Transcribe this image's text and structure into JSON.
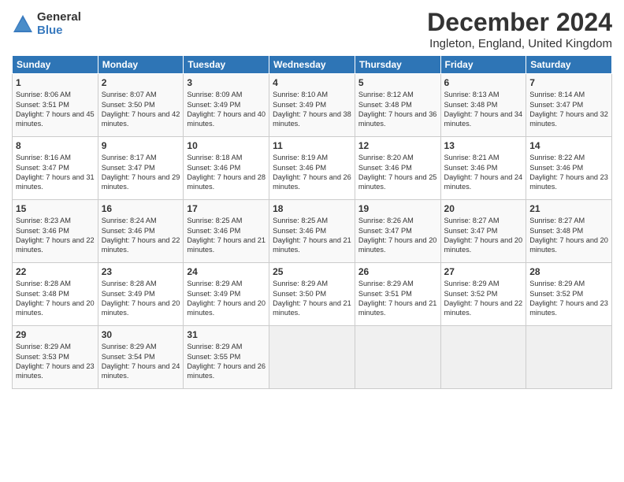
{
  "logo": {
    "general": "General",
    "blue": "Blue"
  },
  "title": "December 2024",
  "subtitle": "Ingleton, England, United Kingdom",
  "headers": [
    "Sunday",
    "Monday",
    "Tuesday",
    "Wednesday",
    "Thursday",
    "Friday",
    "Saturday"
  ],
  "weeks": [
    [
      {
        "day": "1",
        "sunrise": "Sunrise: 8:06 AM",
        "sunset": "Sunset: 3:51 PM",
        "daylight": "Daylight: 7 hours and 45 minutes."
      },
      {
        "day": "2",
        "sunrise": "Sunrise: 8:07 AM",
        "sunset": "Sunset: 3:50 PM",
        "daylight": "Daylight: 7 hours and 42 minutes."
      },
      {
        "day": "3",
        "sunrise": "Sunrise: 8:09 AM",
        "sunset": "Sunset: 3:49 PM",
        "daylight": "Daylight: 7 hours and 40 minutes."
      },
      {
        "day": "4",
        "sunrise": "Sunrise: 8:10 AM",
        "sunset": "Sunset: 3:49 PM",
        "daylight": "Daylight: 7 hours and 38 minutes."
      },
      {
        "day": "5",
        "sunrise": "Sunrise: 8:12 AM",
        "sunset": "Sunset: 3:48 PM",
        "daylight": "Daylight: 7 hours and 36 minutes."
      },
      {
        "day": "6",
        "sunrise": "Sunrise: 8:13 AM",
        "sunset": "Sunset: 3:48 PM",
        "daylight": "Daylight: 7 hours and 34 minutes."
      },
      {
        "day": "7",
        "sunrise": "Sunrise: 8:14 AM",
        "sunset": "Sunset: 3:47 PM",
        "daylight": "Daylight: 7 hours and 32 minutes."
      }
    ],
    [
      {
        "day": "8",
        "sunrise": "Sunrise: 8:16 AM",
        "sunset": "Sunset: 3:47 PM",
        "daylight": "Daylight: 7 hours and 31 minutes."
      },
      {
        "day": "9",
        "sunrise": "Sunrise: 8:17 AM",
        "sunset": "Sunset: 3:47 PM",
        "daylight": "Daylight: 7 hours and 29 minutes."
      },
      {
        "day": "10",
        "sunrise": "Sunrise: 8:18 AM",
        "sunset": "Sunset: 3:46 PM",
        "daylight": "Daylight: 7 hours and 28 minutes."
      },
      {
        "day": "11",
        "sunrise": "Sunrise: 8:19 AM",
        "sunset": "Sunset: 3:46 PM",
        "daylight": "Daylight: 7 hours and 26 minutes."
      },
      {
        "day": "12",
        "sunrise": "Sunrise: 8:20 AM",
        "sunset": "Sunset: 3:46 PM",
        "daylight": "Daylight: 7 hours and 25 minutes."
      },
      {
        "day": "13",
        "sunrise": "Sunrise: 8:21 AM",
        "sunset": "Sunset: 3:46 PM",
        "daylight": "Daylight: 7 hours and 24 minutes."
      },
      {
        "day": "14",
        "sunrise": "Sunrise: 8:22 AM",
        "sunset": "Sunset: 3:46 PM",
        "daylight": "Daylight: 7 hours and 23 minutes."
      }
    ],
    [
      {
        "day": "15",
        "sunrise": "Sunrise: 8:23 AM",
        "sunset": "Sunset: 3:46 PM",
        "daylight": "Daylight: 7 hours and 22 minutes."
      },
      {
        "day": "16",
        "sunrise": "Sunrise: 8:24 AM",
        "sunset": "Sunset: 3:46 PM",
        "daylight": "Daylight: 7 hours and 22 minutes."
      },
      {
        "day": "17",
        "sunrise": "Sunrise: 8:25 AM",
        "sunset": "Sunset: 3:46 PM",
        "daylight": "Daylight: 7 hours and 21 minutes."
      },
      {
        "day": "18",
        "sunrise": "Sunrise: 8:25 AM",
        "sunset": "Sunset: 3:46 PM",
        "daylight": "Daylight: 7 hours and 21 minutes."
      },
      {
        "day": "19",
        "sunrise": "Sunrise: 8:26 AM",
        "sunset": "Sunset: 3:47 PM",
        "daylight": "Daylight: 7 hours and 20 minutes."
      },
      {
        "day": "20",
        "sunrise": "Sunrise: 8:27 AM",
        "sunset": "Sunset: 3:47 PM",
        "daylight": "Daylight: 7 hours and 20 minutes."
      },
      {
        "day": "21",
        "sunrise": "Sunrise: 8:27 AM",
        "sunset": "Sunset: 3:48 PM",
        "daylight": "Daylight: 7 hours and 20 minutes."
      }
    ],
    [
      {
        "day": "22",
        "sunrise": "Sunrise: 8:28 AM",
        "sunset": "Sunset: 3:48 PM",
        "daylight": "Daylight: 7 hours and 20 minutes."
      },
      {
        "day": "23",
        "sunrise": "Sunrise: 8:28 AM",
        "sunset": "Sunset: 3:49 PM",
        "daylight": "Daylight: 7 hours and 20 minutes."
      },
      {
        "day": "24",
        "sunrise": "Sunrise: 8:29 AM",
        "sunset": "Sunset: 3:49 PM",
        "daylight": "Daylight: 7 hours and 20 minutes."
      },
      {
        "day": "25",
        "sunrise": "Sunrise: 8:29 AM",
        "sunset": "Sunset: 3:50 PM",
        "daylight": "Daylight: 7 hours and 21 minutes."
      },
      {
        "day": "26",
        "sunrise": "Sunrise: 8:29 AM",
        "sunset": "Sunset: 3:51 PM",
        "daylight": "Daylight: 7 hours and 21 minutes."
      },
      {
        "day": "27",
        "sunrise": "Sunrise: 8:29 AM",
        "sunset": "Sunset: 3:52 PM",
        "daylight": "Daylight: 7 hours and 22 minutes."
      },
      {
        "day": "28",
        "sunrise": "Sunrise: 8:29 AM",
        "sunset": "Sunset: 3:52 PM",
        "daylight": "Daylight: 7 hours and 23 minutes."
      }
    ],
    [
      {
        "day": "29",
        "sunrise": "Sunrise: 8:29 AM",
        "sunset": "Sunset: 3:53 PM",
        "daylight": "Daylight: 7 hours and 23 minutes."
      },
      {
        "day": "30",
        "sunrise": "Sunrise: 8:29 AM",
        "sunset": "Sunset: 3:54 PM",
        "daylight": "Daylight: 7 hours and 24 minutes."
      },
      {
        "day": "31",
        "sunrise": "Sunrise: 8:29 AM",
        "sunset": "Sunset: 3:55 PM",
        "daylight": "Daylight: 7 hours and 26 minutes."
      },
      null,
      null,
      null,
      null
    ]
  ],
  "colors": {
    "header_bg": "#2e75b6",
    "header_text": "#ffffff",
    "accent": "#3a7bbf"
  }
}
